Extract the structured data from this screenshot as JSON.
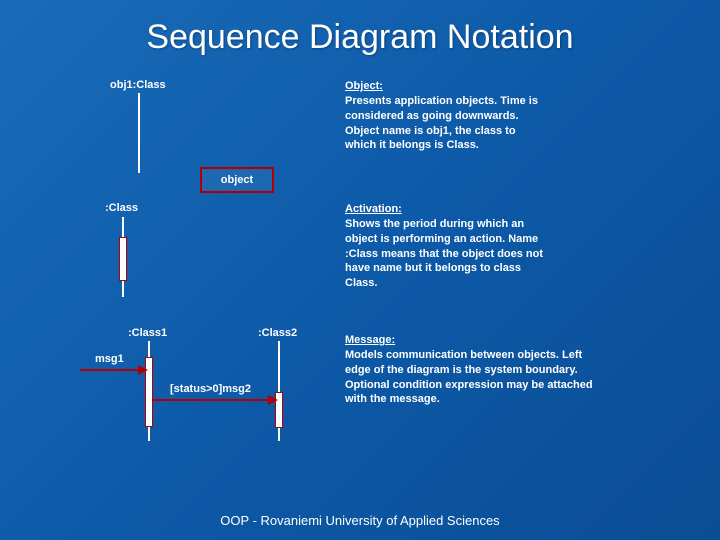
{
  "title": "Sequence Diagram Notation",
  "footer": "OOP - Rovaniemi University of Applied Sciences",
  "diagram": {
    "obj1": "obj1:Class",
    "objectBox": "object",
    "classLabel": ":Class",
    "class1": ":Class1",
    "class2": ":Class2",
    "msg1": "msg1",
    "msg2": "[status>0]msg2"
  },
  "descriptions": {
    "object": {
      "head": "Object:",
      "body": "Presents application objects. Time is considered as going downwards. Object name is obj1, the class to which it belongs is Class."
    },
    "activation": {
      "head": "Activation:",
      "body": "Shows the period during which an object is performing an action. Name :Class means that the object does not have name but it belongs to class Class."
    },
    "message": {
      "head": "Message:",
      "body": "Models communication between objects. Left edge of the diagram is the system boundary. Optional condition expression may be attached with the message."
    }
  }
}
